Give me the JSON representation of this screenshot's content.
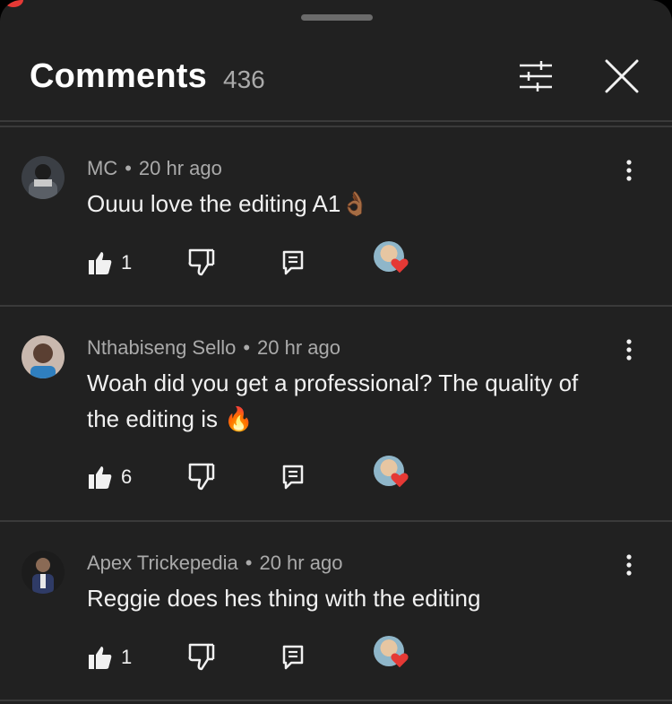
{
  "header": {
    "title": "Comments",
    "count": "436"
  },
  "comments": [
    {
      "author": "MC",
      "separator": "•",
      "time": "20 hr ago",
      "text": "Ouuu love the editing A1👌🏾",
      "likes": "1",
      "creator_hearted": true
    },
    {
      "author": "Nthabiseng Sello",
      "separator": "•",
      "time": "20 hr ago",
      "text": "Woah did you get a professional? The quality of the editing is 🔥",
      "likes": "6",
      "creator_hearted": true
    },
    {
      "author": "Apex Trickepedia",
      "separator": "•",
      "time": "20 hr ago",
      "text": "Reggie does hes thing with the editing",
      "likes": "1",
      "creator_hearted": true
    }
  ],
  "icons": {
    "filter": "sliders-icon",
    "close": "close-icon",
    "menu": "more-vertical-icon",
    "like": "thumb-up-icon",
    "dislike": "thumb-down-icon",
    "reply": "reply-icon",
    "heart": "heart-icon"
  },
  "colors": {
    "background": "#212121",
    "text_primary": "#f1f1f1",
    "text_secondary": "#aaaaaa",
    "divider": "#3a3a3a",
    "heart": "#e53935"
  }
}
